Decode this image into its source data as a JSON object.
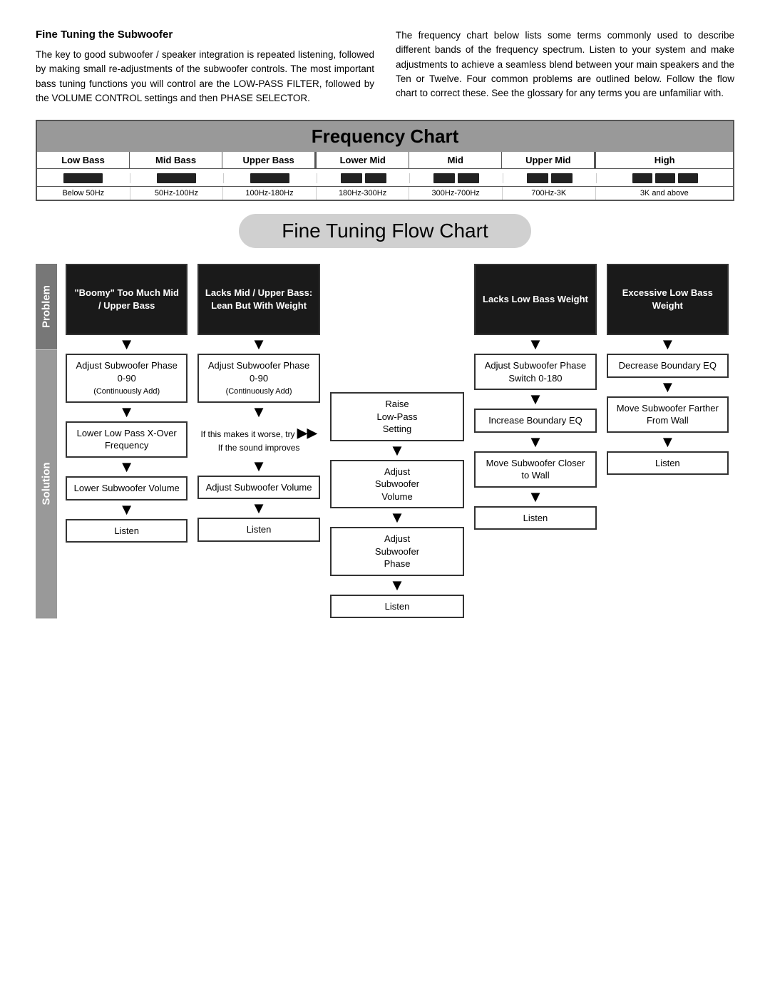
{
  "top_left": {
    "heading": "Fine Tuning the Subwoofer",
    "body": "The key to good subwoofer / speaker integration is repeated listening, followed by making small re-adjustments of the subwoofer controls. The most important bass tuning functions you will control are the LOW-PASS FILTER, followed by the VOLUME CONTROL settings and then PHASE SELECTOR."
  },
  "top_right": {
    "body": "The frequency chart below lists some terms commonly used to describe different bands of the frequency spectrum. Listen to your system and make adjustments to achieve a seamless blend between your main speakers and the Ten or Twelve. Four common problems are outlined below. Follow the flow chart to correct these. See the glossary for any terms you are unfamiliar with."
  },
  "freq_chart": {
    "title": "Frequency Chart",
    "bands": [
      "Low Bass",
      "Mid Bass",
      "Upper Bass",
      "Lower Mid",
      "Mid",
      "Upper Mid",
      "High"
    ],
    "hz": [
      "Below 50Hz",
      "50Hz-100Hz",
      "100Hz-180Hz",
      "180Hz-300Hz",
      "300Hz-700Hz",
      "700Hz-3K",
      "3K and above"
    ]
  },
  "flow_title": "Fine Tuning Flow Chart",
  "labels": {
    "problem": "Problem",
    "solution": "Solution"
  },
  "problems": [
    "\"Boomy\" Too Much Mid / Upper Bass",
    "Lacks Mid / Upper Bass: Lean But With Weight",
    "Lacks Low Bass Weight",
    "Excessive Low Bass Weight"
  ],
  "col1": {
    "s1": "Adjust Subwoofer Phase 0-90",
    "s1_sub": "(Continuously Add)",
    "s2": "Lower Low Pass X-Over Frequency",
    "s3": "Lower Subwoofer Volume",
    "s4": "Listen"
  },
  "col2": {
    "s1": "Adjust Subwoofer Phase 0-90",
    "s1_sub": "(Continuously Add)",
    "branch_if": "If this makes it worse, try",
    "branch_if2": "If the sound improves",
    "s2": "Raise Low-Pass Setting",
    "s3": "Adjust Subwoofer Volume",
    "s4": "Listen"
  },
  "col3": {
    "s1": "Adjust Subwoofer Phase Switch 0-180",
    "s2": "Increase Boundary EQ",
    "s3": "Move Subwoofer Closer to Wall",
    "s4": "Listen"
  },
  "col4": {
    "s1": "Decrease Boundary EQ",
    "s2": "Move Subwoofer Farther From Wall",
    "s3": "Listen"
  },
  "final_col2": {
    "s1": "Adjust Subwoofer Volume",
    "s2": "Adjust Subwoofer Phase",
    "s3": "Listen"
  }
}
